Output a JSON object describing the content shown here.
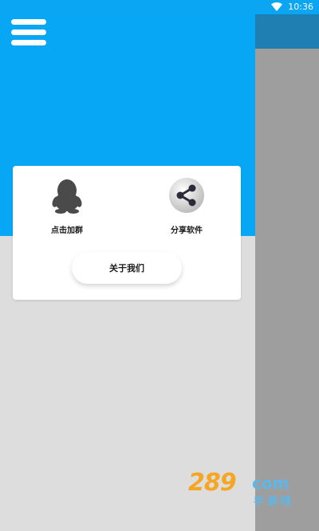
{
  "status_bar": {
    "time": "10:36",
    "wifi_icon": "wifi-icon"
  },
  "toolbar": {
    "menu_icon": "hamburger-menu-icon"
  },
  "card": {
    "join_group": {
      "icon": "qq-penguin-icon",
      "label": "点击加群"
    },
    "share_app": {
      "icon": "share-icon",
      "label": "分享软件"
    },
    "about_button_label": "关于我们"
  },
  "watermark": {
    "digits": "289",
    "domain": "com",
    "subtitle": "手游网"
  },
  "colors": {
    "header_blue": "#07a7f5",
    "background_gray": "#dddddd",
    "drawer_gray": "#9e9e9e",
    "drawer_header": "#1f7fb3",
    "card_white": "#ffffff",
    "icon_gray": "#4a4a4a"
  }
}
